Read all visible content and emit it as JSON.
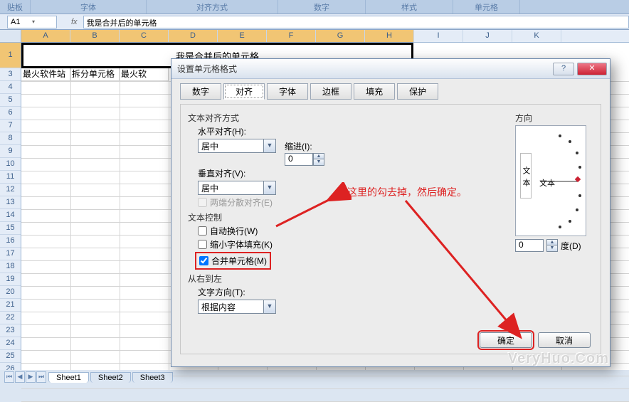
{
  "ribbon_groups": [
    "贴板",
    "字体",
    "对齐方式",
    "数字",
    "样式",
    "单元格"
  ],
  "namebox": "A1",
  "fx_label": "fx",
  "formula": "我是合并后的单元格",
  "columns": [
    "A",
    "B",
    "C",
    "D",
    "E",
    "F",
    "G",
    "H",
    "I",
    "J",
    "K"
  ],
  "merged_text": "我是合并后的单元格",
  "row3": [
    "最火软件站",
    "拆分单元格",
    "最火软"
  ],
  "sheet_tabs": [
    "Sheet1",
    "Sheet2",
    "Sheet3"
  ],
  "dialog": {
    "title": "设置单元格格式",
    "tabs": [
      "数字",
      "对齐",
      "字体",
      "边框",
      "填充",
      "保护"
    ],
    "text_align_section": "文本对齐方式",
    "h_align_label": "水平对齐(H):",
    "h_align_value": "居中",
    "indent_label": "缩进(I):",
    "indent_value": "0",
    "v_align_label": "垂直对齐(V):",
    "v_align_value": "居中",
    "justify_dist": "两端分散对齐(E)",
    "text_ctrl_section": "文本控制",
    "wrap": "自动换行(W)",
    "shrink": "缩小字体填充(K)",
    "merge": "合并单元格(M)",
    "rtl_section": "从右到左",
    "text_dir_label": "文字方向(T):",
    "text_dir_value": "根据内容",
    "direction_section": "方向",
    "orient_vert": "文本",
    "orient_txt": "文本",
    "degree_value": "0",
    "degree_label": "度(D)",
    "ok": "确定",
    "cancel": "取消"
  },
  "annotation": "将这里的勾去掉，然后确定。",
  "watermark": "VeryHuo.Com"
}
